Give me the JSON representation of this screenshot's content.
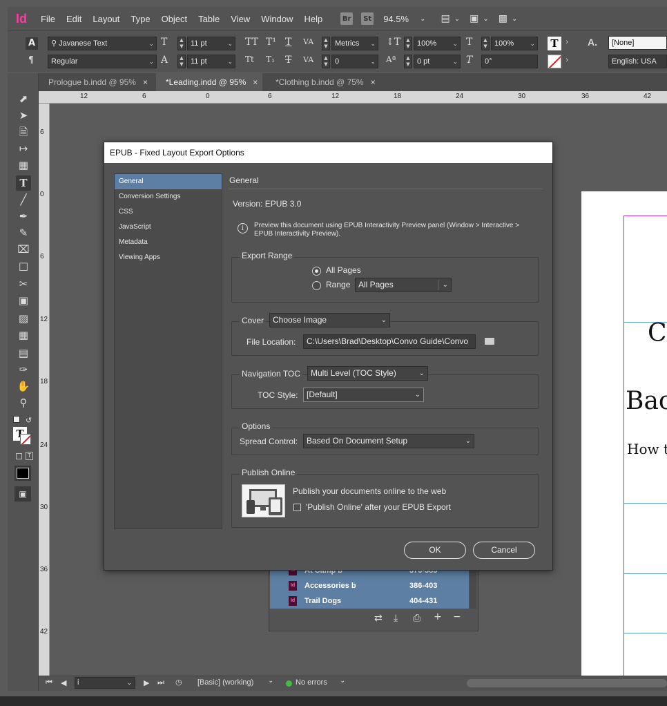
{
  "menubar": {
    "logo": "Id",
    "items": [
      "File",
      "Edit",
      "Layout",
      "Type",
      "Object",
      "Table",
      "View",
      "Window",
      "Help"
    ],
    "bridge_badge": "Br",
    "stock_badge": "St",
    "zoom": "94.5%"
  },
  "control": {
    "font_family": "Javanese Text",
    "font_style": "Regular",
    "font_size": "11 pt",
    "leading": "11 pt",
    "kerning": "Metrics",
    "tracking": "0",
    "vscale": "100%",
    "hscale": "100%",
    "baseline": "0 pt",
    "skew": "0°",
    "char_style": "[None]",
    "language": "English: USA"
  },
  "tabs": [
    {
      "label": "Prologue b.indd @ 95%",
      "close": "×"
    },
    {
      "label": "*Leading.indd @ 95%",
      "close": "×"
    },
    {
      "label": "*Clothing b.indd @ 75%",
      "close": "×"
    }
  ],
  "hruler": [
    "12",
    "6",
    "0",
    "6",
    "12",
    "18",
    "24",
    "30",
    "36",
    "42"
  ],
  "vruler": [
    "6",
    "0",
    "6",
    "12",
    "18",
    "24",
    "30",
    "36",
    "42"
  ],
  "page_text": {
    "line1": "C",
    "line2": "Bac",
    "line3": "How t"
  },
  "books": {
    "rows": [
      {
        "name": "At Camp b",
        "pages": "376-385"
      },
      {
        "name": "Accessories b",
        "pages": "386-403"
      },
      {
        "name": "Trail Dogs",
        "pages": "404-431"
      }
    ]
  },
  "status": {
    "page": "i",
    "style": "[Basic] (working)",
    "errors": "No errors"
  },
  "dialog": {
    "title": "EPUB - Fixed Layout Export Options",
    "nav": [
      "General",
      "Conversion Settings",
      "CSS",
      "JavaScript",
      "Metadata",
      "Viewing Apps"
    ],
    "heading": "General",
    "version": "Version: EPUB 3.0",
    "info": "Preview this document using EPUB Interactivity Preview panel (Window > Interactive > EPUB Interactivity Preview).",
    "export_range": {
      "label": "Export Range",
      "all_pages": "All Pages",
      "range": "Range",
      "range_value": "All Pages"
    },
    "cover": {
      "label": "Cover",
      "value": "Choose Image",
      "file_location_label": "File Location:",
      "file_location": "C:\\Users\\Brad\\Desktop\\Convo Guide\\Convo"
    },
    "nav_toc": {
      "label": "Navigation TOC",
      "value": "Multi Level (TOC Style)",
      "toc_style_label": "TOC Style:",
      "toc_style": "[Default]"
    },
    "options": {
      "label": "Options",
      "spread_label": "Spread Control:",
      "spread_value": "Based On Document Setup"
    },
    "publish": {
      "label": "Publish Online",
      "desc": "Publish your documents online to the web",
      "checkbox": "'Publish Online' after your EPUB Export"
    },
    "ok": "OK",
    "cancel": "Cancel"
  },
  "colors": {
    "accent": "#5d7fa3",
    "app_pink": "#ff3aa3",
    "frame": "#c024c0"
  }
}
